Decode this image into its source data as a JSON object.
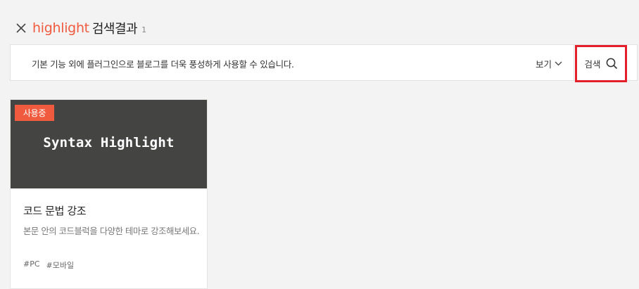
{
  "header": {
    "query": "highlight",
    "title_suffix": "검색결과",
    "result_count": "1"
  },
  "toolbar": {
    "description": "기본 기능 외에 플러그인으로 블로그를 더욱 풍성하게 사용할 수 있습니다.",
    "view_label": "보기",
    "search_label": "검색"
  },
  "results": [
    {
      "badge": "사용중",
      "thumbnail_text": "Syntax Highlight",
      "title": "코드 문법 강조",
      "description": "본문 안의 코드블럭을 다양한 테마로 강조해보세요.",
      "tags": [
        "#PC",
        "#모바일"
      ]
    }
  ],
  "colors": {
    "accent": "#f05a3e",
    "highlight_box": "#e3202a",
    "thumbnail_bg": "#444443",
    "page_bg": "#f3f3f3"
  },
  "icons": {
    "close": "close-icon",
    "view_dropdown": "chevron-down-icon",
    "search": "search-icon"
  }
}
